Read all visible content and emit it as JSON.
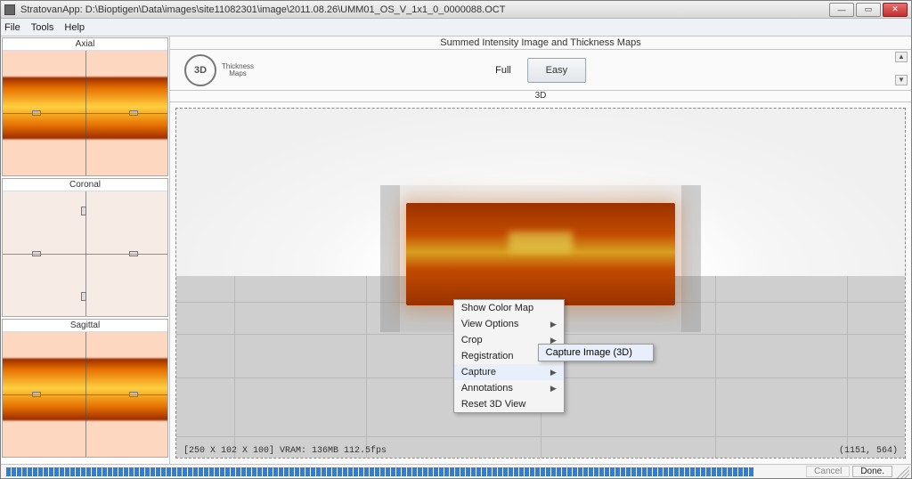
{
  "window": {
    "title": "StratovanApp: D:\\Bioptigen\\Data\\images\\site11082301\\image\\2011.08.26\\UMM01_OS_V_1x1_0_0000088.OCT"
  },
  "menubar": [
    "File",
    "Tools",
    "Help"
  ],
  "left_panel": {
    "views": [
      "Axial",
      "Coronal",
      "Sagittal"
    ]
  },
  "main": {
    "title": "Summed Intensity Image and Thickness Maps",
    "tool_3d": "3D",
    "tool_thickness": "Thickness\nMaps",
    "full_label": "Full",
    "easy_label": "Easy",
    "sub_title": "3D",
    "vp_status": "[250 X 102 X 100]  VRAM: 136MB 112.5fps",
    "vp_coords": "(1151,  564)"
  },
  "context_menu": {
    "items": [
      {
        "label": "Show Color Map",
        "submenu": false
      },
      {
        "label": "View Options",
        "submenu": true
      },
      {
        "label": "Crop",
        "submenu": true
      },
      {
        "label": "Registration",
        "submenu": true
      },
      {
        "label": "Capture",
        "submenu": true,
        "highlight": true
      },
      {
        "label": "Annotations",
        "submenu": true
      },
      {
        "label": "Reset 3D View",
        "submenu": false
      }
    ],
    "submenu_capture": [
      {
        "label": "Capture Image (3D)",
        "highlight": true
      }
    ]
  },
  "bottom": {
    "cancel": "Cancel",
    "done": "Done."
  }
}
